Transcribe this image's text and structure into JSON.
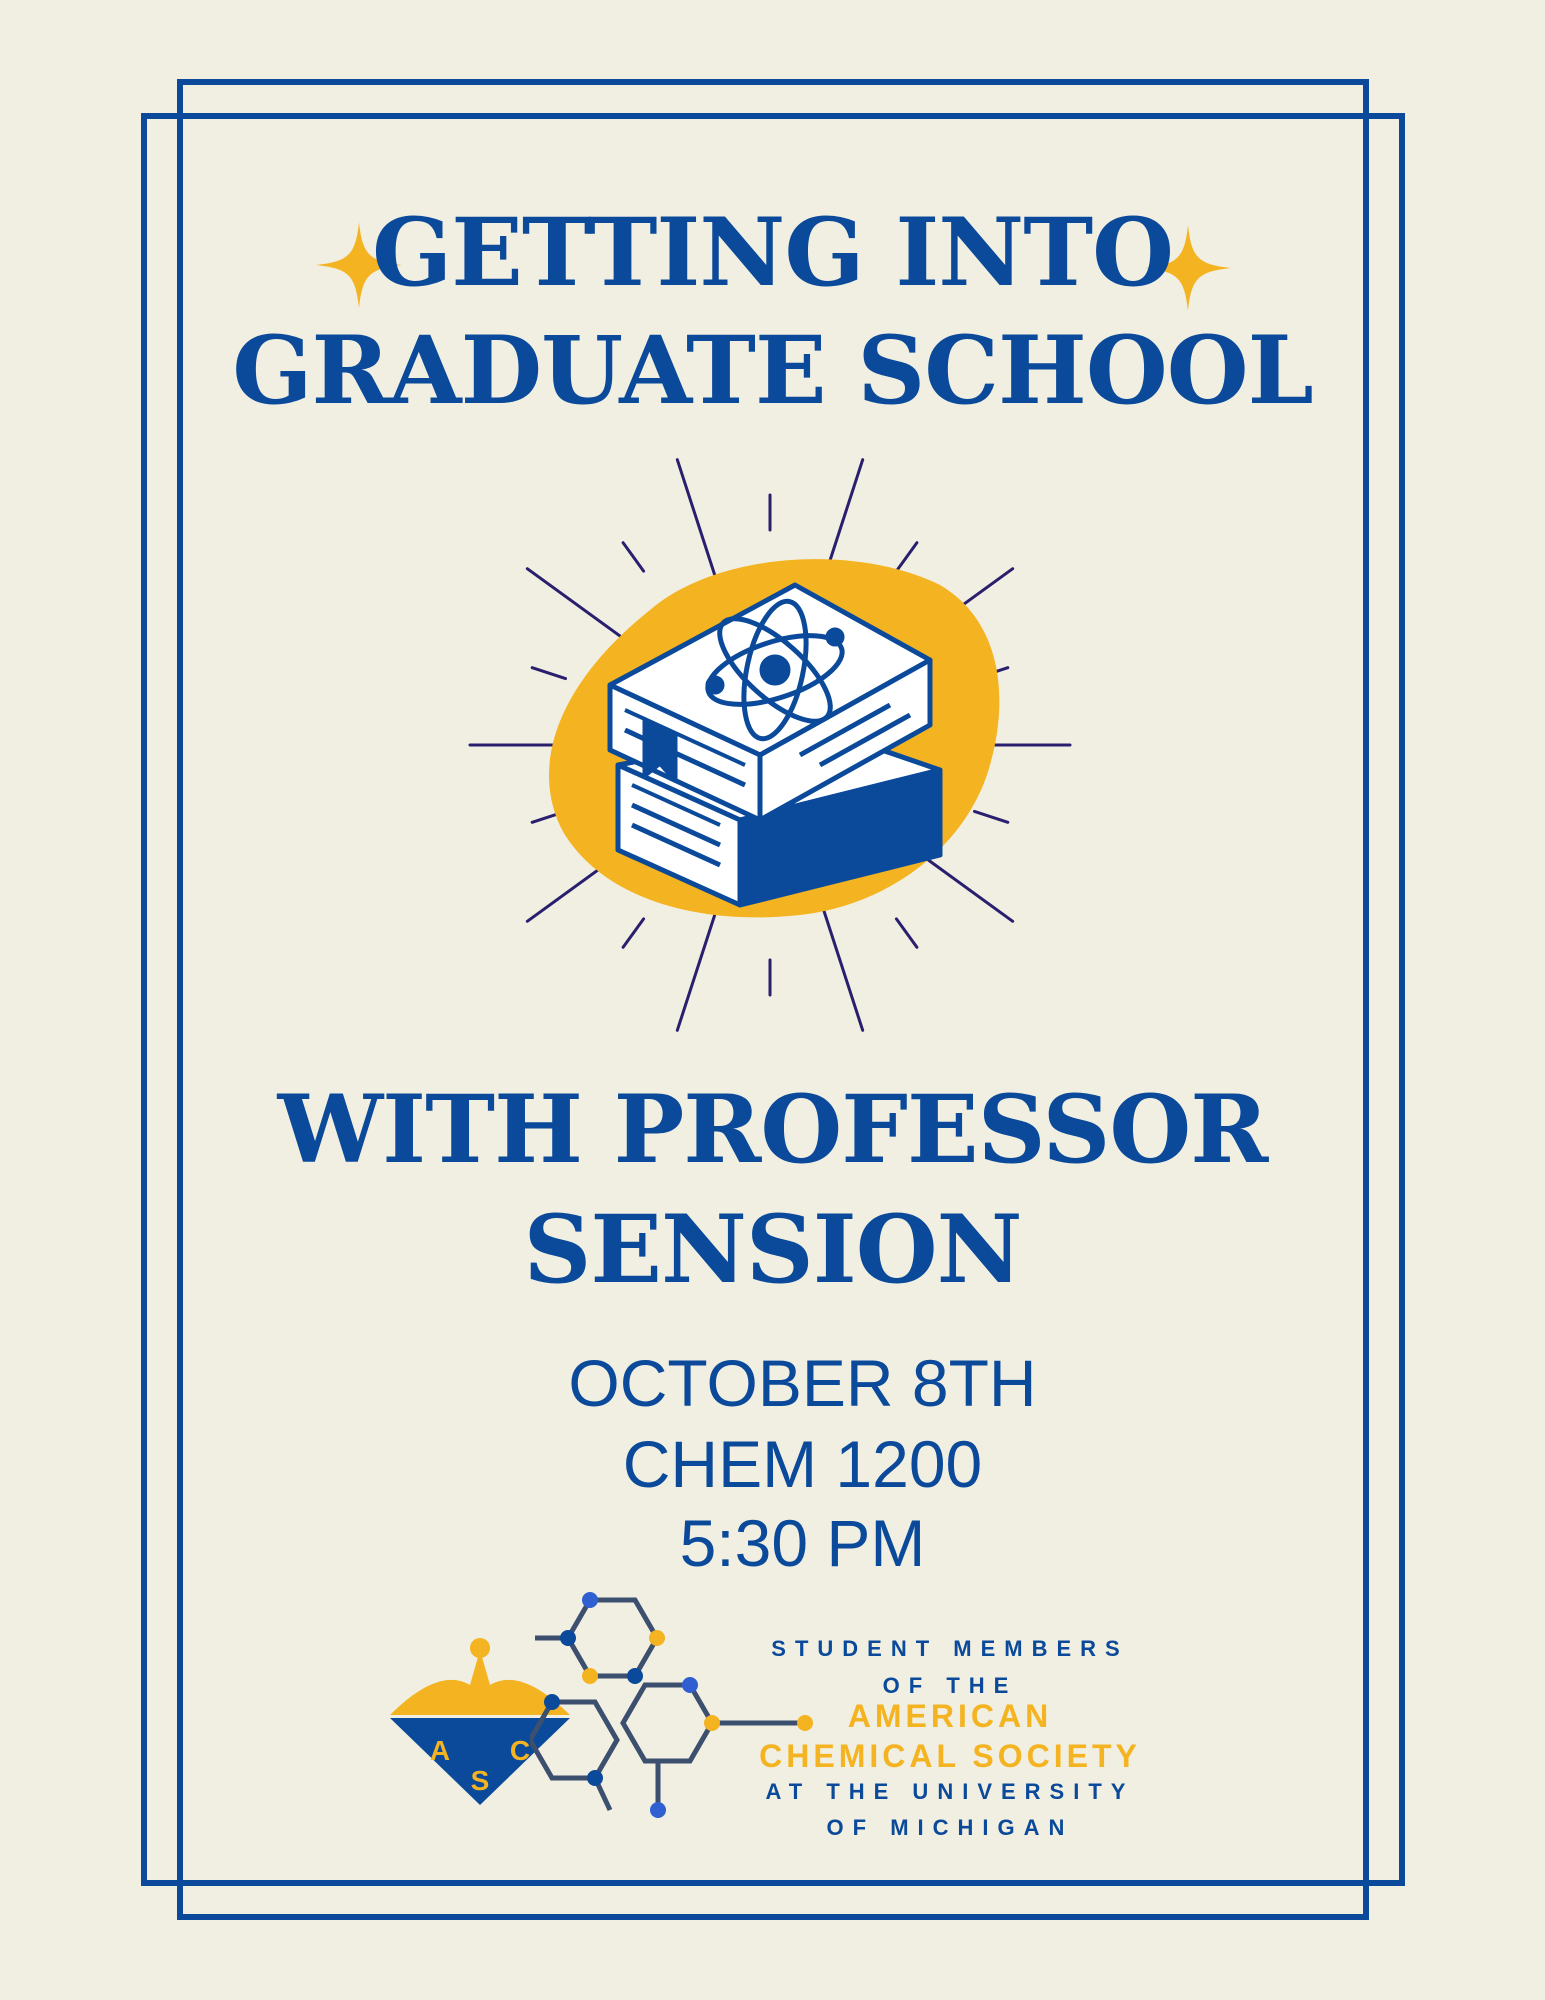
{
  "poster": {
    "title_line1": "GETTING INTO",
    "title_line2": "GRADUATE SCHOOL",
    "subtitle_line1": "WITH PROFESSOR",
    "subtitle_line2": "SENSION",
    "date": "OCTOBER 8TH",
    "room": "CHEM 1200",
    "time": "5:30 PM"
  },
  "organization": {
    "line1": "STUDENT MEMBERS",
    "line2": "OF THE",
    "line3": "AMERICAN",
    "line4": "CHEMICAL SOCIETY",
    "line5": "AT THE UNIVERSITY",
    "line6": "OF MICHIGAN",
    "logo_letters": [
      "A",
      "C",
      "S"
    ]
  },
  "colors": {
    "background": "#f1efe2",
    "navy": "#0b4a9a",
    "gold": "#f4b321",
    "ray": "#2a1f6e"
  },
  "icons": [
    "sparkle-icon",
    "book-stack-icon",
    "atom-icon",
    "eagle-icon",
    "molecule-icon"
  ]
}
